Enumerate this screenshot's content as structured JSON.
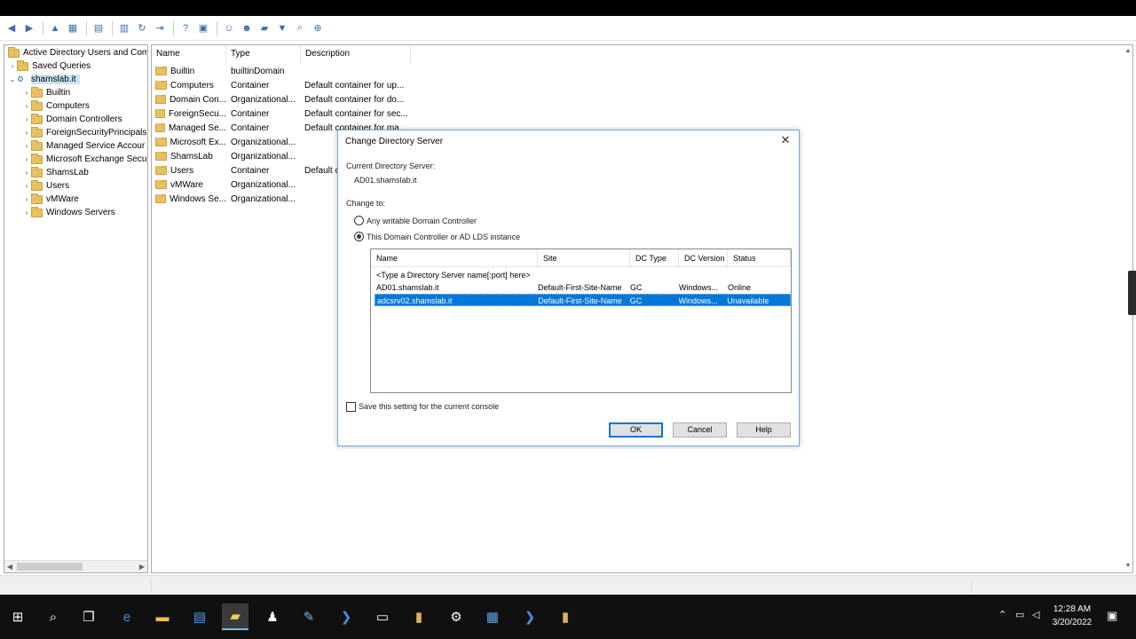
{
  "tree": {
    "root_label": "Active Directory Users and Com",
    "saved_queries": "Saved Queries",
    "domain": "shamslab.it",
    "children": [
      "Builtin",
      "Computers",
      "Domain Controllers",
      "ForeignSecurityPrincipals",
      "Managed Service Accour",
      "Microsoft Exchange Secu",
      "ShamsLab",
      "Users",
      "vMWare",
      "Windows Servers"
    ]
  },
  "list": {
    "headers": [
      "Name",
      "Type",
      "Description"
    ],
    "rows": [
      {
        "name": "Builtin",
        "type": "builtinDomain",
        "desc": ""
      },
      {
        "name": "Computers",
        "type": "Container",
        "desc": "Default container for up..."
      },
      {
        "name": "Domain Con...",
        "type": "Organizational...",
        "desc": "Default container for do..."
      },
      {
        "name": "ForeignSecu...",
        "type": "Container",
        "desc": "Default container for sec..."
      },
      {
        "name": "Managed Se...",
        "type": "Container",
        "desc": "Default container for ma..."
      },
      {
        "name": "Microsoft Ex...",
        "type": "Organizational...",
        "desc": ""
      },
      {
        "name": "ShamsLab",
        "type": "Organizational...",
        "desc": ""
      },
      {
        "name": "Users",
        "type": "Container",
        "desc": "Default c"
      },
      {
        "name": "vMWare",
        "type": "Organizational...",
        "desc": ""
      },
      {
        "name": "Windows Se...",
        "type": "Organizational...",
        "desc": ""
      }
    ]
  },
  "dialog": {
    "title": "Change Directory Server",
    "current_label": "Current Directory Server:",
    "current_value": "AD01.shamslab.it",
    "change_to_label": "Change to:",
    "radio_any": "Any writable Domain Controller",
    "radio_this": "This Domain Controller or AD LDS instance",
    "grid": {
      "headers": [
        "Name",
        "Site",
        "DC Type",
        "DC Version",
        "Status"
      ],
      "placeholder_row": "<Type a Directory Server name[:port] here>",
      "rows": [
        {
          "name": "AD01.shamslab.it",
          "site": "Default-First-Site-Name",
          "dctype": "GC",
          "dcversion": "Windows...",
          "status": "Online"
        },
        {
          "name": "adcsrv02.shamslab.it",
          "site": "Default-First-Site-Name",
          "dctype": "GC",
          "dcversion": "Windows...",
          "status": "Unavailable"
        }
      ]
    },
    "save_setting": "Save this setting for the current console",
    "ok_label": "OK",
    "cancel_label": "Cancel",
    "help_label": "Help"
  },
  "taskbar": {
    "time": "12:28 AM",
    "date": "3/20/2022"
  }
}
